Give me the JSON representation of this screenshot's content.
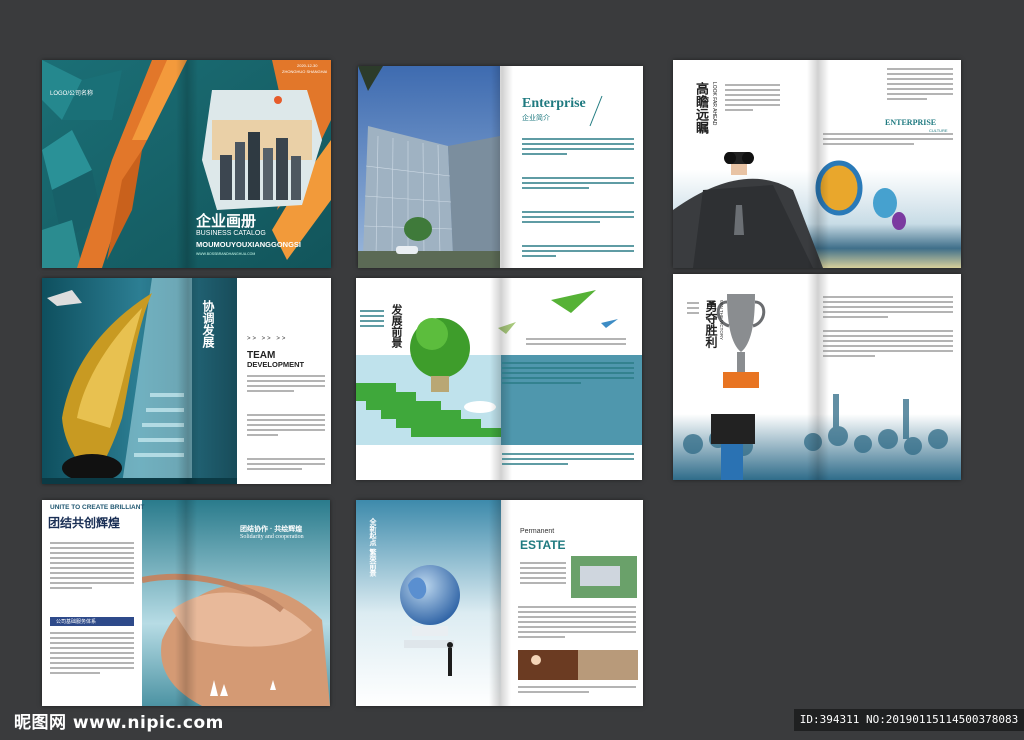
{
  "spread1": {
    "logo": "LOGO/公司名称",
    "date": "2020-12-30",
    "place": "ZHONGHUO SHANGHAI",
    "title_cn": "企业画册",
    "title_en": "BUSINESS CATALOG",
    "subtitle": "MOUMOUYOUXIANGGONGSI",
    "small": "WWW.BOSSBRANDHANGHUA.COM"
  },
  "spread2": {
    "title_en": "Enterprise",
    "title_cn": "企业简介"
  },
  "spread3": {
    "vertical_cn": "高瞻远瞩",
    "vertical_en": "LOOK FAR AHEAD",
    "right_title": "ENTERPRISE",
    "right_sub": "CULTURE"
  },
  "spread4": {
    "vertical_cn": "协调发展",
    "arrows": ">> >> >>",
    "team": "TEAM",
    "dev": "DEVELOPMENT"
  },
  "spread5": {
    "vertical_cn": "发展前景"
  },
  "spread6": {
    "vertical_cn": "勇夺胜利",
    "vertical_en": "WIN THE VICTORY"
  },
  "spread7": {
    "head_en": "UNITE TO CREATE BRILLIANT",
    "head_cn": "团结共创辉煌",
    "right_cn": "团结协作 · 共绘辉煌",
    "right_en": "Solidarity and cooperation",
    "box": "公司基础服务体系"
  },
  "spread8": {
    "vertical_cn": "全新起点 繁荣前景",
    "perm": "Permanent",
    "estate": "ESTATE"
  },
  "footer": {
    "watermark": "昵图网 www.nipic.com",
    "id": "ID:394311 NO:20190115114500378083"
  },
  "colors": {
    "background": "#3a3b3d",
    "teal": "#1f7a80",
    "orange": "#e2772a"
  }
}
